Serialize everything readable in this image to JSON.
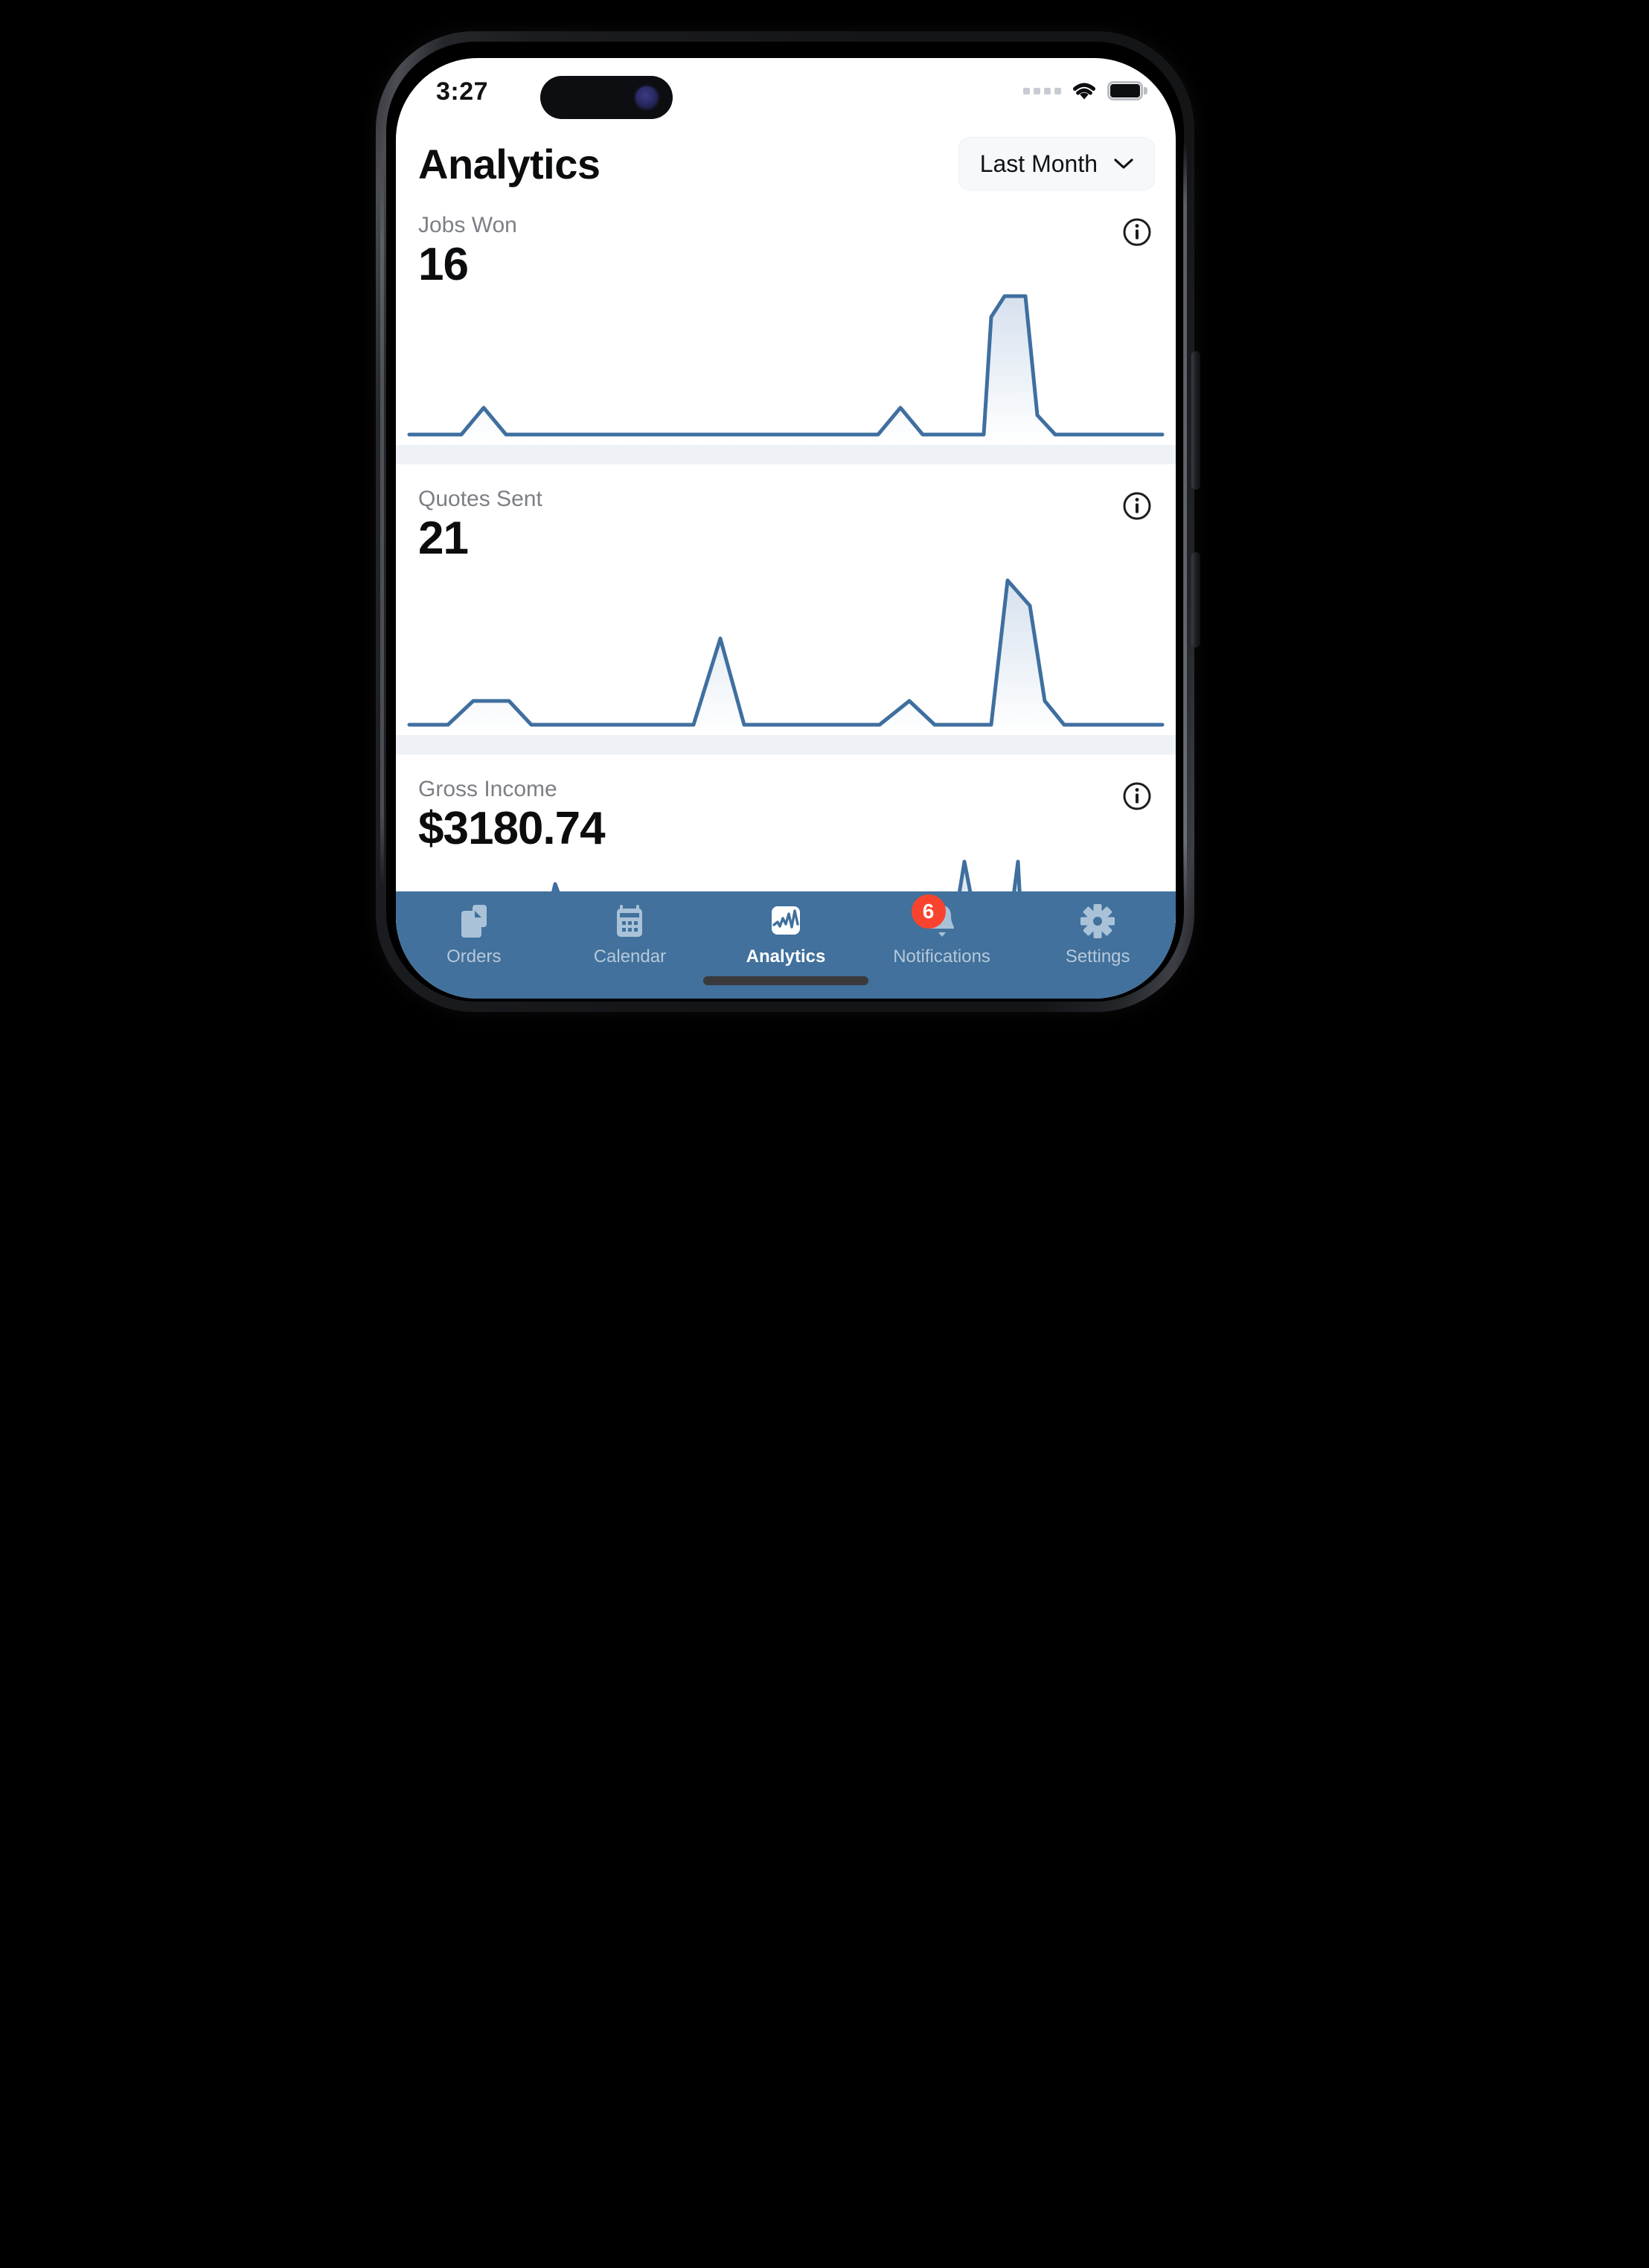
{
  "status_bar": {
    "time": "3:27",
    "icons": [
      "cellular-dots-icon",
      "wifi-icon",
      "battery-icon"
    ]
  },
  "header": {
    "title": "Analytics",
    "range_picker": {
      "label": "Last Month",
      "chevron": "chevron-down-icon"
    }
  },
  "colors": {
    "accent": "#41719c",
    "line": "#3f6f9f",
    "area_top": "#dbe4ef",
    "area_bottom": "#ffffff",
    "card_foot": "#eef1f5",
    "badge": "#f8442e",
    "label": "#7c7f85",
    "value": "#0b0c0e"
  },
  "cards": [
    {
      "label": "Jobs Won",
      "value": "16",
      "info": "info-icon"
    },
    {
      "label": "Quotes Sent",
      "value": "21",
      "info": "info-icon"
    },
    {
      "label": "Gross Income",
      "value": "$3180.74",
      "info": "info-icon"
    }
  ],
  "tabs": [
    {
      "label": "Orders",
      "icon": "documents-icon",
      "active": false,
      "badge": null
    },
    {
      "label": "Calendar",
      "icon": "calendar-icon",
      "active": false,
      "badge": null
    },
    {
      "label": "Analytics",
      "icon": "line-chart-icon",
      "active": true,
      "badge": null
    },
    {
      "label": "Notifications",
      "icon": "bell-icon",
      "active": false,
      "badge": "6"
    },
    {
      "label": "Settings",
      "icon": "gear-icon",
      "active": false,
      "badge": null
    }
  ],
  "chart_data": [
    {
      "type": "area",
      "title": "Jobs Won",
      "xlabel": "",
      "ylabel": "",
      "ylim": [
        0,
        6
      ],
      "grid": false,
      "legend": "none",
      "x": [
        0,
        1,
        2,
        3,
        4,
        5,
        6,
        7,
        8,
        9,
        10,
        11,
        12,
        13,
        14,
        15,
        16,
        17,
        18,
        19,
        20,
        21,
        22,
        23,
        24,
        25,
        26
      ],
      "values": [
        0,
        0,
        0,
        0,
        1,
        0,
        0,
        0,
        0,
        0,
        0,
        0,
        0,
        0,
        0,
        0,
        0,
        0,
        0,
        1,
        0,
        0,
        0,
        0,
        4.2,
        6,
        0.6,
        0
      ]
    },
    {
      "type": "area",
      "title": "Quotes Sent",
      "xlabel": "",
      "ylabel": "",
      "ylim": [
        0,
        6
      ],
      "grid": false,
      "legend": "none",
      "x": [
        0,
        1,
        2,
        3,
        4,
        5,
        6,
        7,
        8,
        9,
        10,
        11,
        12,
        13,
        14,
        15,
        16,
        17,
        18,
        19,
        20,
        21,
        22,
        23,
        24,
        25,
        26
      ],
      "values": [
        0,
        0,
        1,
        1,
        0,
        0,
        0,
        0,
        0,
        0,
        3.4,
        0,
        0,
        0,
        0,
        0,
        1,
        0,
        0,
        0,
        0,
        0,
        6,
        5.3,
        0.9,
        0
      ]
    },
    {
      "type": "area",
      "title": "Gross Income",
      "xlabel": "",
      "ylabel": "",
      "ylim": [
        0,
        1000
      ],
      "grid": false,
      "legend": "none",
      "x": [
        0,
        1,
        2,
        3,
        4,
        5,
        6,
        7,
        8,
        9,
        10,
        11,
        12,
        13,
        14,
        15,
        16,
        17,
        18,
        19,
        20,
        21,
        22,
        23,
        24,
        25,
        26
      ],
      "values": [
        0,
        0,
        0,
        0,
        640,
        0,
        0,
        440,
        360,
        0,
        0,
        0,
        0,
        0,
        0,
        0,
        0,
        0,
        0,
        0,
        0,
        900,
        0,
        880,
        330
      ]
    }
  ]
}
